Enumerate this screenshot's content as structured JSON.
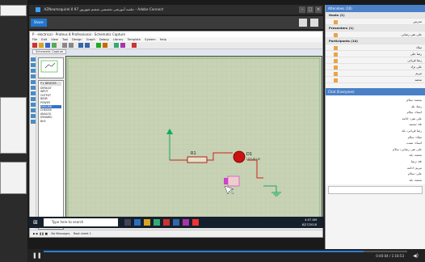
{
  "recording": {
    "window_title": "AZNeamsquirel.0 جلسه آموزشی تخصصی ششم شهریور 97 - Adobe Connect",
    "share_tab": "Share",
    "share_tab_extra": "Stop Sharing"
  },
  "proteus": {
    "title": "P - electrical - Proteus 8 Professional - Schematic Capture",
    "menu": [
      "File",
      "Edit",
      "View",
      "Tool",
      "Design",
      "Graph",
      "Debug",
      "Library",
      "Template",
      "System",
      "Help"
    ],
    "tab": "Schematic Capture",
    "devices_header": "P L   DEVICES",
    "devices": [
      "DEFAULT",
      "INPUT",
      "OUTPUT",
      "BIDIR",
      "POWER",
      "GROUND",
      "CHASSIS",
      "ANALOG",
      "DYNAMIC",
      "BUS"
    ],
    "selected_device": "GROUND",
    "components": {
      "resistor": "R1",
      "led": "D1",
      "led_type": "LED-BLUE"
    },
    "status_text": "No Messages",
    "status_sheet": "Root sheet 1"
  },
  "taskbar": {
    "search_placeholder": "Type here to search",
    "time": "4:07 AM",
    "date": "8/27/2018"
  },
  "right_panel": {
    "attendees_header": "Attendees (16)",
    "hosts_header": "Hosts (1)",
    "presenters_header": "Presenters (1)",
    "participants_header": "Participants (14)",
    "hosts": [
      "مدرس"
    ],
    "presenters": [
      "علی تقی رضایی"
    ],
    "participants": [
      "میلاد",
      "رضا علی",
      "رضا قربانی",
      "علی نژاد",
      "مریم",
      "محمد"
    ],
    "chat_header": "Chat (Everyone)",
    "chat": [
      "محمد: سلام",
      "رضا: بله",
      "استاد: سلام",
      "علی تقی: ادامه",
      "محمد: ok",
      "رضا قربانی: بله",
      "میلاد: سلام",
      "استاد: تست",
      "علی تقی رضایی: سلام",
      "محمد: بله",
      "رضا: ok",
      "مریم: ادامه",
      "علی: سلام",
      "محمد: بله"
    ]
  },
  "player": {
    "time": "0:40:04 / 1:16:53",
    "progress": 0.88
  }
}
